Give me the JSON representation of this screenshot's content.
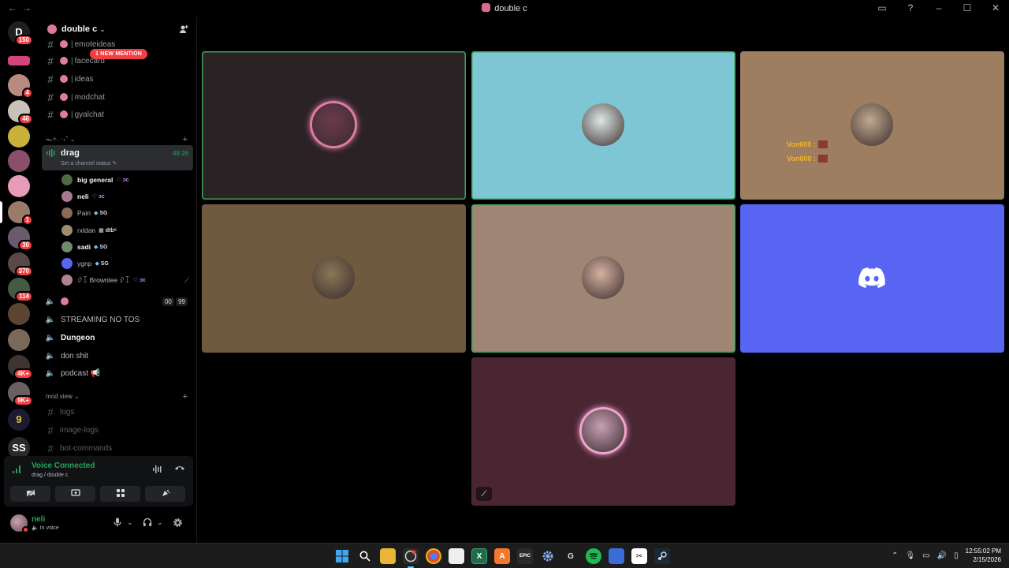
{
  "window": {
    "title": "double c",
    "nav_back": "←",
    "nav_fwd": "→",
    "controls": [
      "▭",
      "?",
      "–",
      "☐",
      "✕"
    ]
  },
  "server_rail": {
    "items": [
      {
        "badge": "150",
        "color": "#1f1f23",
        "label": "D"
      },
      {
        "badge": "",
        "color": "#d5437c",
        "label": ""
      },
      {
        "badge": "4",
        "color": "#b98b7e",
        "label": ""
      },
      {
        "badge": "46",
        "color": "#c8c2b8",
        "label": ""
      },
      {
        "badge": "",
        "color": "#c9b13b",
        "label": ""
      },
      {
        "badge": "",
        "color": "#8a4f6b",
        "label": ""
      },
      {
        "badge": "",
        "color": "#e79bb8",
        "label": ""
      },
      {
        "badge": "1",
        "color": "#9a7a6b",
        "label": ""
      },
      {
        "badge": "30",
        "color": "#6b5a6b",
        "label": ""
      },
      {
        "badge": "370",
        "color": "#5a4747",
        "label": ""
      },
      {
        "badge": "114",
        "color": "#455a45",
        "label": ""
      },
      {
        "badge": "",
        "color": "#5a4535",
        "label": ""
      },
      {
        "badge": "",
        "color": "#7a6858",
        "label": ""
      },
      {
        "badge": "4K+",
        "color": "#3e3530",
        "label": ""
      },
      {
        "badge": "9K+",
        "color": "#6a6060",
        "label": ""
      },
      {
        "badge": "",
        "color": "#1c1c30",
        "label": "9"
      },
      {
        "badge": "",
        "color": "#2a2a2a",
        "label": "SS"
      }
    ]
  },
  "guild": {
    "name": "double c",
    "chevron": "⌄",
    "invite_icon": "add-member-icon"
  },
  "channels": {
    "new_mention": "1 NEW MENTION",
    "text": [
      {
        "name": "emoteideas"
      },
      {
        "name": "facecard"
      },
      {
        "name": "ideas"
      },
      {
        "name": "modchat"
      },
      {
        "name": "gyalchat"
      }
    ],
    "category1": "ᯓ✧. ‧₊˚ ⌄",
    "active_voice": {
      "name": "drag",
      "time": "49:26",
      "status": "Set a channel status ✎"
    },
    "voice_users": [
      {
        "name": "big general",
        "tag": "♡ ɔc",
        "tag_type": "heart",
        "color": "#4c6b43",
        "bold": true,
        "muted": false
      },
      {
        "name": "neli",
        "tag": "♡ ɔc",
        "tag_type": "heart",
        "color": "#a87a92",
        "bold": true,
        "muted": false
      },
      {
        "name": "Pain",
        "tag": "SG",
        "tag_type": "gem",
        "color": "#8b6a56",
        "bold": false,
        "muted": false
      },
      {
        "name": "rxldan",
        "tag": "dtb⁸",
        "tag_type": "plain",
        "color": "#a08c6c",
        "bold": false,
        "muted": false
      },
      {
        "name": "sadi",
        "tag": "SG",
        "tag_type": "gem",
        "color": "#6c8c6a",
        "bold": true,
        "muted": false
      },
      {
        "name": "ygnp",
        "tag": "SG",
        "tag_type": "gem",
        "color": "#5865f2",
        "bold": false,
        "muted": false
      },
      {
        "name": "ꂑꀤ Brownlee ꂑꀤ",
        "tag": "♡ ɔc",
        "tag_type": "heart",
        "color": "#b08094",
        "bold": false,
        "muted": true
      }
    ],
    "voice_channels": [
      {
        "name": "",
        "has_flower": true,
        "count": "00",
        "count2": "99",
        "bold": false
      },
      {
        "name": "STREAMING NO TOS",
        "has_flower": false,
        "count": "",
        "bold": false
      },
      {
        "name": "Dungeon",
        "has_flower": false,
        "count": "",
        "bold": true
      },
      {
        "name": "don shit",
        "has_flower": false,
        "count": "",
        "bold": false
      },
      {
        "name": "podcast 📢",
        "has_flower": false,
        "count": "",
        "bold": false
      }
    ],
    "category2": "mod view ⌄",
    "mod_channels": [
      {
        "name": "logs"
      },
      {
        "name": "image-logs"
      },
      {
        "name": "bot-commands"
      }
    ]
  },
  "voice_panel": {
    "title": "Voice Connected",
    "subtitle": "drag / double c",
    "buttons": [
      "camera-off-icon",
      "screen-share-icon",
      "activities-icon",
      "soundboard-icon"
    ]
  },
  "user": {
    "name": "neli",
    "status": "🔈 In voice"
  },
  "tiles": [
    {
      "bg": "#2a2224",
      "speaking": true,
      "avatar": "#6b3a4e",
      "ring": "#e07aa6"
    },
    {
      "bg": "#7ec6d3",
      "speaking": true,
      "avatar": "#dce8e5",
      "ring": ""
    },
    {
      "bg": "#9e7e60",
      "speaking": false,
      "avatar": "#c0a98e",
      "ring": "",
      "chat": [
        "Von600 :",
        "Von600 :"
      ]
    },
    {
      "bg": "#6f5a40",
      "speaking": false,
      "avatar": "#8a7858",
      "ring": ""
    },
    {
      "bg": "#9f8573",
      "speaking": true,
      "avatar": "#d4b2a0",
      "ring": ""
    },
    {
      "bg": "#5865f2",
      "speaking": false,
      "avatar": "",
      "ring": "",
      "discord": true
    },
    {
      "bg": "#4a2632",
      "speaking": false,
      "avatar": "#c7a0b4",
      "ring": "#f0a3d0",
      "muted": true
    }
  ],
  "taskbar": {
    "clock_time": "12:55:02 PM",
    "clock_date": "2/15/2026"
  }
}
